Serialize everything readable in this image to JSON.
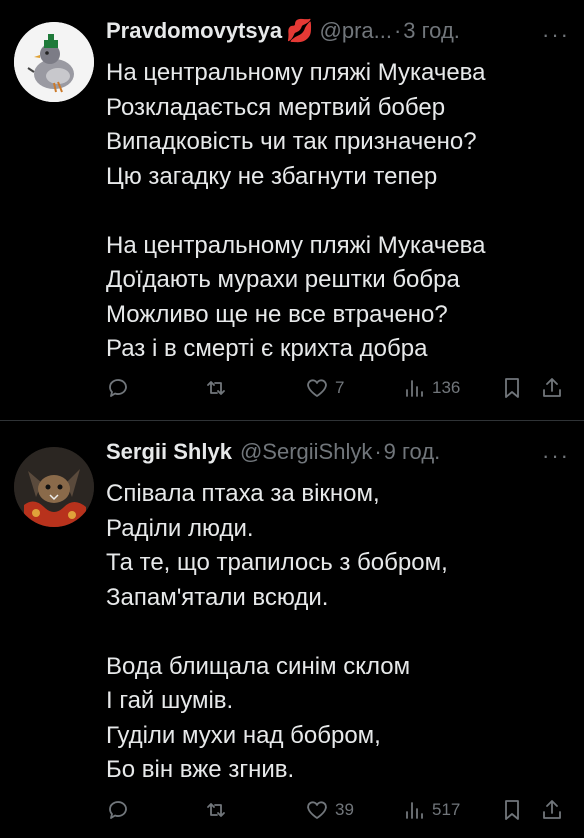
{
  "posts": [
    {
      "author_name": "Pravdomovytsya",
      "author_emoji": "💋",
      "handle": "@pra...",
      "separator": "·",
      "time": "3 год.",
      "more": "···",
      "lines": [
        "На центральному пляжі Мукачева",
        "Розкладається мертвий бобер",
        "Випадковість чи так призначено?",
        "Цю загадку не збагнути тепер",
        "",
        "На центральному пляжі Мукачева",
        "Доїдають мурахи рештки бобра",
        "Можливо ще не все втрачено?",
        "Раз і в смерті є крихта добра"
      ],
      "actions": {
        "reply_count": "",
        "repost_count": "",
        "like_count": "7",
        "views_count": "136"
      }
    },
    {
      "author_name": "Sergii Shlyk",
      "handle": "@SergiiShlyk",
      "separator": "·",
      "time": "9 год.",
      "more": "···",
      "lines": [
        "Співала птаха за вікном,",
        "Раділи люди.",
        "Та те, що трапилось з бобром,",
        "Запам'ятали всюди.",
        "",
        "Вода блищала синім склом",
        "І гай шумів.",
        "Гуділи мухи над бобром,",
        "Бо він вже згнив."
      ],
      "actions": {
        "reply_count": "",
        "repost_count": "",
        "like_count": "39",
        "views_count": "517"
      }
    }
  ],
  "icons": {
    "reply": "reply-icon",
    "repost": "repost-icon",
    "like": "like-icon",
    "views": "views-icon",
    "bookmark": "bookmark-icon",
    "share": "share-icon"
  },
  "colors": {
    "background": "#000000",
    "text": "#e7e9ea",
    "muted": "#71767b",
    "divider": "#2f3336"
  }
}
